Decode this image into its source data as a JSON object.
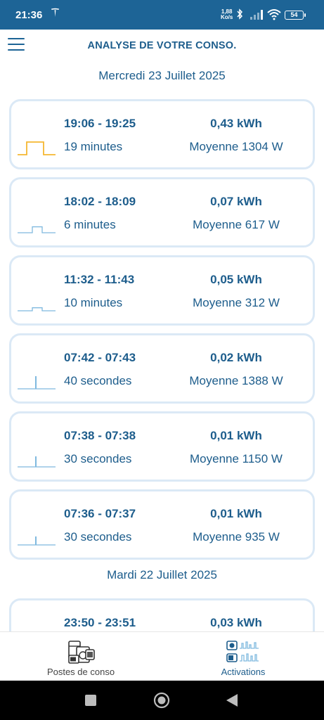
{
  "status_bar": {
    "time": "21:36",
    "net_speed": "1,88",
    "net_unit": "Ko/s",
    "battery": "54",
    "icons": [
      "tesla-icon",
      "bluetooth-icon",
      "signal-icon",
      "wifi-icon",
      "battery-icon"
    ]
  },
  "header": {
    "title": "ANALYSE DE VOTRE CONSO.",
    "menu_icon": "hamburger-menu-icon"
  },
  "days": [
    {
      "label": "Mercredi 23 Juillet 2025",
      "activations": [
        {
          "time_range": "19:06 - 19:25",
          "duration": "19 minutes",
          "energy": "0,43 kWh",
          "average": "Moyenne 1304 W",
          "color": "#f5b731",
          "level": 1.0,
          "shape": "wide"
        },
        {
          "time_range": "18:02 - 18:09",
          "duration": "6 minutes",
          "energy": "0,07 kWh",
          "average": "Moyenne 617 W",
          "color": "#7fb9df",
          "level": 0.47,
          "shape": "medium"
        },
        {
          "time_range": "11:32 - 11:43",
          "duration": "10 minutes",
          "energy": "0,05 kWh",
          "average": "Moyenne 312 W",
          "color": "#7fb9df",
          "level": 0.24,
          "shape": "medium"
        },
        {
          "time_range": "07:42 - 07:43",
          "duration": "40 secondes",
          "energy": "0,02 kWh",
          "average": "Moyenne 1388 W",
          "color": "#7fb9df",
          "level": 1.0,
          "shape": "spike"
        },
        {
          "time_range": "07:38 - 07:38",
          "duration": "30 secondes",
          "energy": "0,01 kWh",
          "average": "Moyenne 1150 W",
          "color": "#7fb9df",
          "level": 0.83,
          "shape": "spike"
        },
        {
          "time_range": "07:36 - 07:37",
          "duration": "30 secondes",
          "energy": "0,01 kWh",
          "average": "Moyenne 935 W",
          "color": "#7fb9df",
          "level": 0.67,
          "shape": "spike"
        }
      ]
    },
    {
      "label": "Mardi 22 Juillet 2025",
      "activations": [
        {
          "time_range": "23:50 - 23:51",
          "energy": "0,03 kWh"
        }
      ]
    }
  ],
  "bottom_nav": {
    "tabs": [
      {
        "label": "Postes de conso",
        "icon": "appliances-icon",
        "active": false
      },
      {
        "label": "Activations",
        "icon": "activations-icon",
        "active": true
      }
    ]
  },
  "colors": {
    "primary": "#1d5d8c",
    "status_bar": "#1d6496",
    "card_border": "#dbe9f6",
    "accent_yellow": "#f5b731",
    "accent_blue": "#7fb9df"
  }
}
